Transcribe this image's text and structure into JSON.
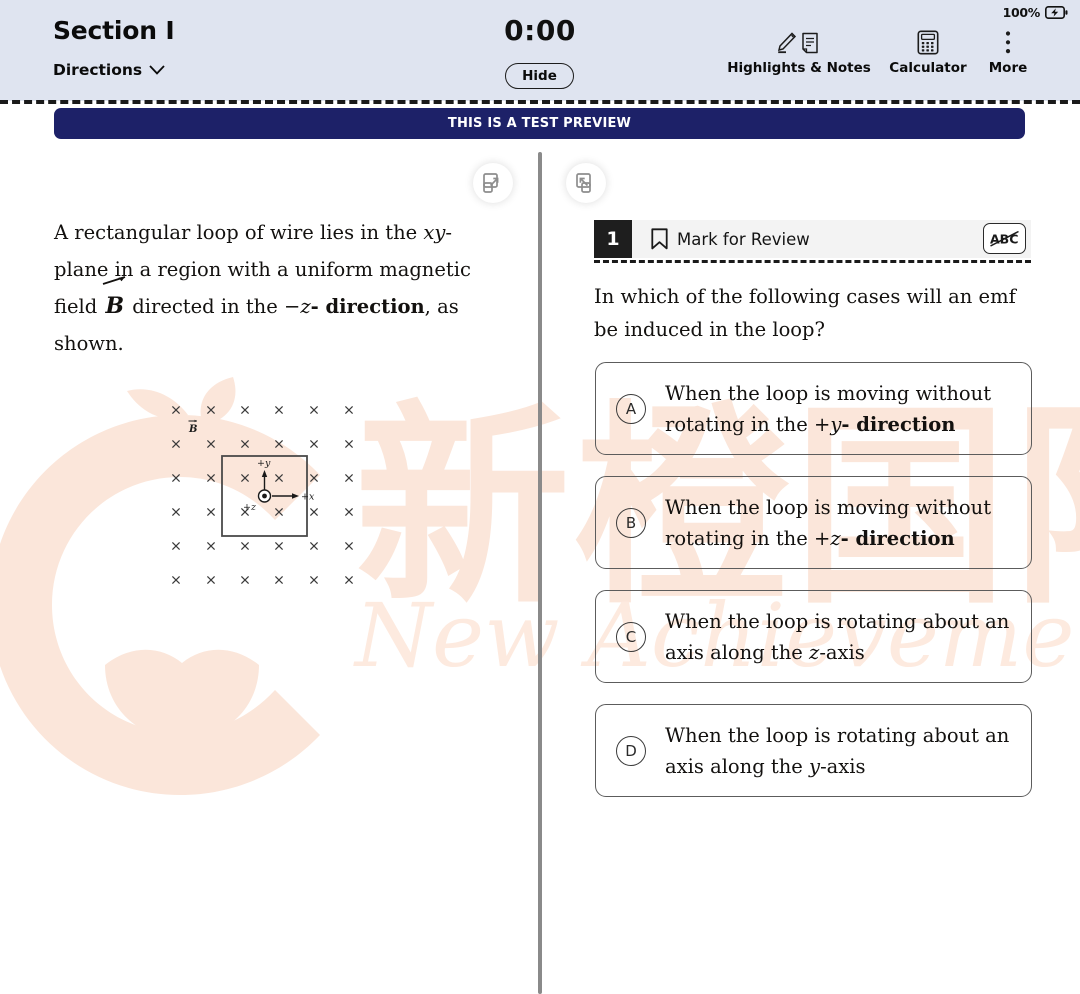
{
  "header": {
    "section_title": "Section I",
    "directions_label": "Directions",
    "directions_icon": "chevron-down-icon",
    "timer": "0:00",
    "hide_label": "Hide",
    "battery_pct": "100%",
    "battery_icon": "battery-charging-icon",
    "tools": [
      {
        "label": "Highlights & Notes",
        "icon": "highlighter-note-icon"
      },
      {
        "label": "Calculator",
        "icon": "calculator-icon"
      },
      {
        "label": "More",
        "icon": "more-vertical-icon"
      }
    ]
  },
  "banner": {
    "text": "THIS IS A TEST PREVIEW",
    "color": "#1d2168"
  },
  "panes": {
    "expand_left_icon": "expand-right-icon",
    "expand_right_icon": "collapse-left-icon"
  },
  "stimulus": {
    "line1": "A rectangular loop of wire lies in the ",
    "xy_italic": "xy",
    "line1b": "-plane in a region with a uniform magnetic field ",
    "vector_b": "B",
    "line2": " directed in the ",
    "minus": "−",
    "z_italic": "z",
    "direction_bold": "- direction",
    "line3": ", as shown."
  },
  "figure": {
    "b_label": "B",
    "axis_y": "+y",
    "axis_x": "+x",
    "axis_z": "+z",
    "field_marker": "×",
    "rows": 6,
    "cols": 6,
    "caption_note": "magnetic field into the page with rectangular loop"
  },
  "question": {
    "number": "1",
    "mark_for_review_label": "Mark for Review",
    "bookmark_icon": "bookmark-icon",
    "cross_out_icon": "abc-strikethrough-icon",
    "prompt": "In which of the following cases will an emf be induced in the loop?",
    "choices": [
      {
        "letter": "A",
        "text_pre": "When the loop is moving without rotating in the ",
        "sign": "+",
        "axis": "y",
        "text_post": "- direction"
      },
      {
        "letter": "B",
        "text_pre": "When the loop is moving without rotating in the ",
        "sign": "+",
        "axis": "z",
        "text_post": "- direction"
      },
      {
        "letter": "C",
        "text_pre": "When the loop is rotating about an axis along the ",
        "sign": "",
        "axis": "z",
        "text_post": "-axis"
      },
      {
        "letter": "D",
        "text_pre": "When the loop is rotating about an axis along the ",
        "sign": "",
        "axis": "y",
        "text_post": "-axis"
      }
    ]
  },
  "watermark": {
    "chinese": "新橙国际",
    "english": "New Achievements",
    "logo": "apple-logo-watermark",
    "color": "#fbe6da"
  }
}
